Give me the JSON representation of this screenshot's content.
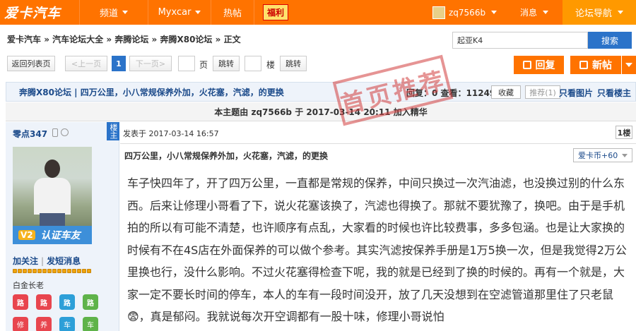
{
  "topnav": {
    "logo": "爱卡汽车",
    "items": [
      "频道",
      "Myxcar",
      "热帖"
    ],
    "fuli": "福利",
    "username": "zq7566b",
    "messages": "消息",
    "forum_nav": "论坛导航"
  },
  "breadcrumb": {
    "items": [
      "爱卡汽车",
      "汽车论坛大全",
      "奔腾论坛",
      "奔腾X80论坛",
      "正文"
    ],
    "separator": "»"
  },
  "search": {
    "value": "起亚K4",
    "button": "搜索"
  },
  "pager": {
    "back": "返回列表页",
    "prev": "上一页",
    "current": "1",
    "next": "下一页",
    "page_label": "页",
    "jump1": "跳转",
    "floor_label": "楼",
    "jump2": "跳转",
    "reply": "回复",
    "new_post": "新帖"
  },
  "thread": {
    "forum": "奔腾X80论坛",
    "title": "四万公里，小八常规保养外加，火花塞，汽滤，的更换",
    "stats": "回复：0  查看：11249",
    "collect": "收藏",
    "recommend": "推荐(1)",
    "only_images": "只看图片",
    "only_op": "只看楼主",
    "topic_note": "本主题由 zq7566b 于 2017-03-14 20:11 加入精华",
    "stamp": "首页推荐"
  },
  "user": {
    "name": "零点347",
    "op_badge": "楼主",
    "badge_v2": "V2",
    "badge_text": "认证车友",
    "follow": "加关注",
    "message": "发短消息",
    "stars": 16,
    "rank": "白金长老",
    "medals_row1": [
      "路",
      "路",
      "路",
      "路"
    ],
    "medals_row2": [
      "修",
      "养",
      "车",
      "车"
    ],
    "medal_colors": [
      "#e8454e",
      "#e8454e",
      "#2d9fd8",
      "#5fb34a"
    ]
  },
  "post": {
    "time": "发表于 2017-03-14 16:57",
    "floor": "1楼",
    "title": "四万公里，小八常规保养外加，火花塞，汽滤，的更换",
    "coin": "爱卡币+60",
    "body": "车子快四年了，开了四万公里，一直都是常规的保养，中间只换过一次汽油滤，也没换过别的什么东西。后来让修理小哥看了下，说火花塞该换了，汽滤也得换了。那就不要犹豫了，换吧。由于是手机拍的所以有可能不清楚，也许顺序有点乱，大家看的时候也许比较费事，多多包涵。也是让大家换的时候有不在4S店在外面保养的可以做个参考。其实汽滤按保养手册是1万5换一次，但是我觉得2万公里换也行，没什么影响。不过火花塞得检查下呢，我的就是已经到了换的时候的。再有一个就是，大家一定不要长时间的停车，本人的车有一段时间没开，放了几天没想到在空滤管道那里住了只老鼠😨，真是郁闷。我就说每次开空调都有一股十味，修理小哥说怕"
  },
  "colors": {
    "brand_orange": "#ff7300",
    "link_blue": "#1b4a8a",
    "button_blue": "#2b73c9"
  }
}
